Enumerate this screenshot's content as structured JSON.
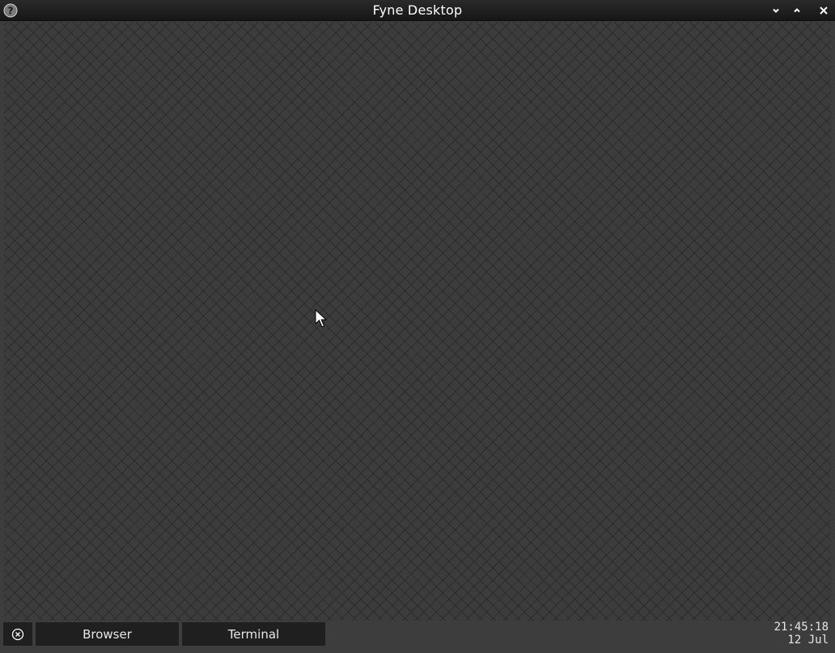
{
  "window": {
    "title": "Fyne Desktop",
    "help_icon": "help-icon",
    "minimize_icon": "chevron-down-icon",
    "maximize_icon": "chevron-up-icon",
    "close_icon": "close-icon"
  },
  "desktop": {
    "pattern": "crosshatch",
    "background_color": "#3c3c3c"
  },
  "taskbar": {
    "launcher_icon": "circle-x-icon",
    "apps": [
      {
        "label": "Browser"
      },
      {
        "label": "Terminal"
      }
    ],
    "clock": {
      "time": "21:45:18",
      "date": "12 Jul"
    }
  },
  "colors": {
    "titlebar": "#1e1e1e",
    "button_bg": "#1f1f1f",
    "text": "#ffffff"
  }
}
